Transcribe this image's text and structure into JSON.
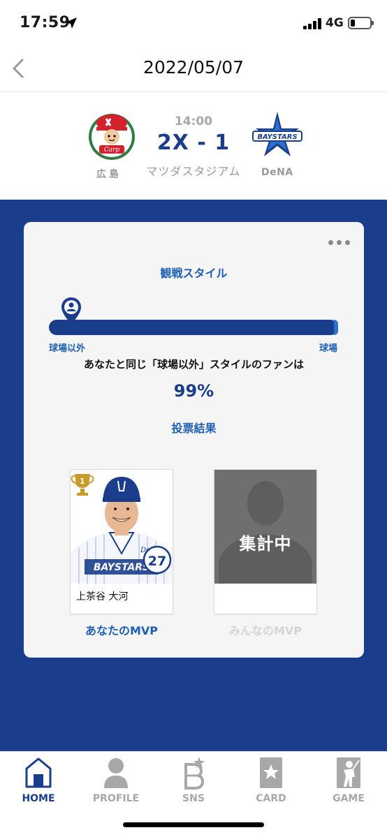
{
  "status_bar": {
    "time": "17:59",
    "network": "4G"
  },
  "header": {
    "title": "2022/05/07"
  },
  "game": {
    "home_team": "広島",
    "away_team": "DeNA",
    "start_time": "14:00",
    "score": "2X - 1",
    "stadium": "マツダスタジアム"
  },
  "card": {
    "watch_style_title": "観戦スタイル",
    "bar_left_label": "球場以外",
    "bar_right_label": "球場",
    "same_style_text": "あなたと同じ「球場以外」スタイルのファンは",
    "same_style_percent": "99%",
    "vote_title": "投票結果",
    "my_mvp": {
      "player_name": "上茶谷 大河",
      "uniform_number": "27",
      "label": "あなたのMVP",
      "jersey_text": "DeNA",
      "logo_text": "BAYSTARS"
    },
    "all_mvp": {
      "status": "集計中",
      "label": "みんなのMVP"
    }
  },
  "logos": {
    "carp_script": "Carp",
    "dena_logo_text": "BAYSTARS"
  },
  "tabs": [
    {
      "label": "HOME",
      "icon": "home-icon",
      "active": true
    },
    {
      "label": "PROFILE",
      "icon": "profile-icon",
      "active": false
    },
    {
      "label": "SNS",
      "icon": "sns-b-icon",
      "active": false
    },
    {
      "label": "CARD",
      "icon": "card-icon",
      "active": false
    },
    {
      "label": "GAME",
      "icon": "game-icon",
      "active": false
    }
  ],
  "colors": {
    "brand_blue": "#1b3e8c",
    "accent_blue": "#1f5fb3",
    "inactive_gray": "#a8a8a8"
  }
}
